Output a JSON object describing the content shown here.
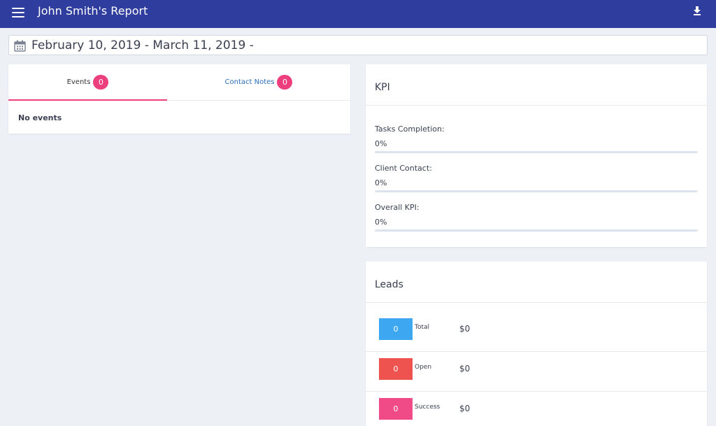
{
  "header": {
    "title": "John Smith's Report",
    "menu_icon": "menu-icon",
    "download_icon": "download-icon",
    "bg_color": "#2f3e9e"
  },
  "date_range": {
    "text": "February 10, 2019 - March 11, 2019 -",
    "icon": "calendar-icon"
  },
  "tabs": [
    {
      "label": "Events",
      "count": "0",
      "active": true
    },
    {
      "label": "Contact Notes",
      "count": "0",
      "active": false
    }
  ],
  "events_empty": "No events",
  "kpi": {
    "title": "KPI",
    "items": [
      {
        "label": "Tasks Completion:",
        "value": "0%",
        "progress": 0
      },
      {
        "label": "Client Contact:",
        "value": "0%",
        "progress": 0
      },
      {
        "label": "Overall KPI:",
        "value": "0%",
        "progress": 0
      }
    ]
  },
  "leads": {
    "title": "Leads",
    "rows": [
      {
        "count": "0",
        "label": "Total",
        "amount": "$0",
        "color": "#3ea7f2"
      },
      {
        "count": "0",
        "label": "Open",
        "amount": "$0",
        "color": "#ef5350"
      },
      {
        "count": "0",
        "label": "Success",
        "amount": "$0",
        "color": "#f04a87"
      }
    ]
  },
  "colors": {
    "accent": "#ee3f7d",
    "link": "#2a6fb8"
  }
}
